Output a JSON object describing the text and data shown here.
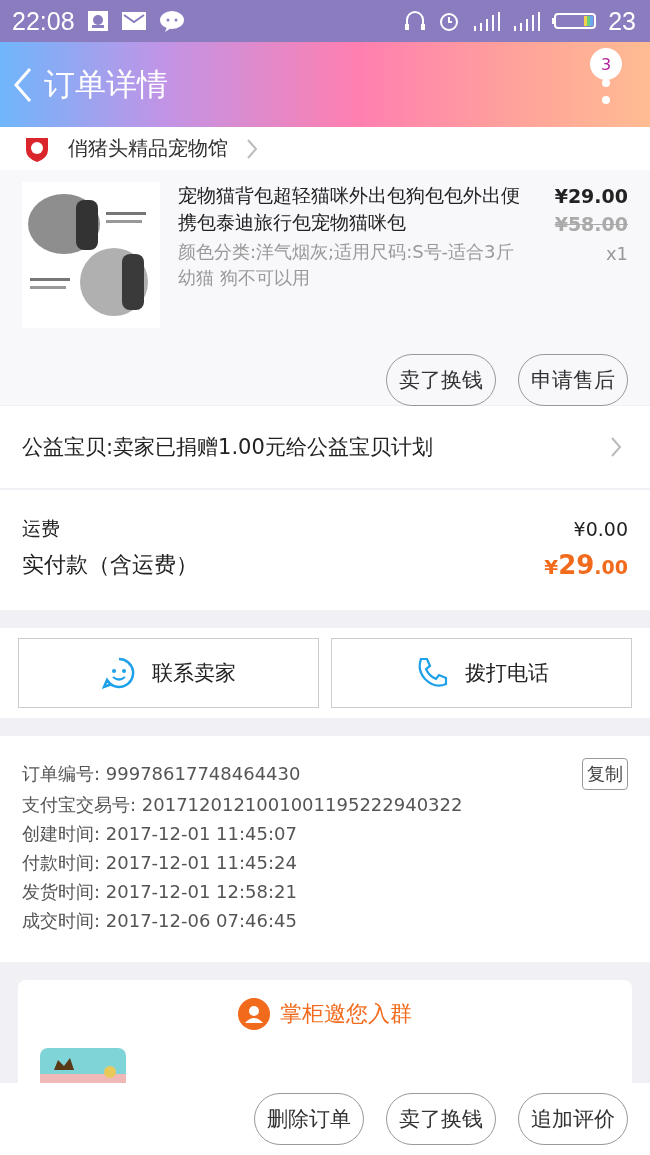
{
  "status_bar": {
    "time": "22:08",
    "battery": "23"
  },
  "header": {
    "title": "订单详情",
    "badge": "3"
  },
  "shop": {
    "name": "俏猪头精品宠物馆"
  },
  "product": {
    "kind": "picture",
    "title": "宠物猫背包超轻猫咪外出包狗包包外出便携包泰迪旅行包宠物猫咪包",
    "sku": "颜色分类:洋气烟灰;适用尺码:S号-适合3斤幼猫 狗不可以用",
    "price": "¥29.00",
    "original_price": "¥58.00",
    "quantity": "x1",
    "actions": [
      "卖了换钱",
      "申请售后"
    ]
  },
  "charity": {
    "text": "公益宝贝:卖家已捐赠1.00元给公益宝贝计划"
  },
  "fees": {
    "shipping_label": "运费",
    "shipping": "¥0.00",
    "total_label": "实付款（含运费）",
    "total_symbol": "¥",
    "total_int": "29",
    "total_dec": ".00"
  },
  "contact": [
    {
      "kind": "chat",
      "label": "联系卖家"
    },
    {
      "kind": "phone",
      "label": "拨打电话"
    }
  ],
  "order_info": {
    "copy": "复制",
    "rows": [
      {
        "label": "订单编号:",
        "value": "99978617748464430"
      },
      {
        "label": "支付宝交易号:",
        "value": "2017120121001001195222940322"
      },
      {
        "label": "创建时间:",
        "value": "2017-12-01 11:45:07"
      },
      {
        "label": "付款时间:",
        "value": "2017-12-01 11:45:24"
      },
      {
        "label": "发货时间:",
        "value": "2017-12-01 12:58:21"
      },
      {
        "label": "成交时间:",
        "value": "2017-12-06 07:46:45"
      }
    ]
  },
  "group": {
    "title": "掌柜邀您入群"
  },
  "bottom_actions": [
    "删除订单",
    "卖了换钱",
    "追加评价"
  ]
}
